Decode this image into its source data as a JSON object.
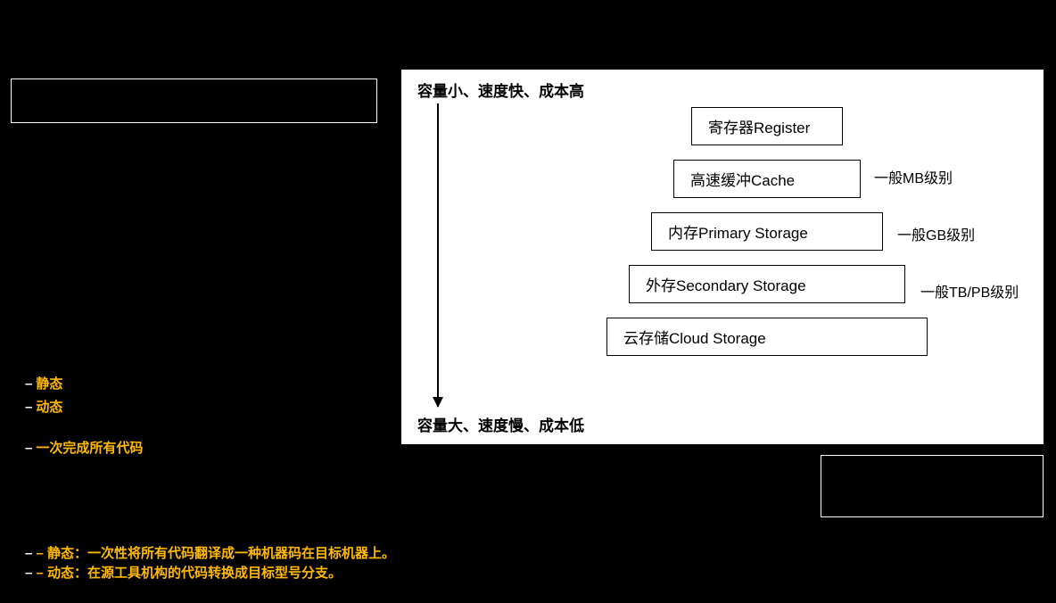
{
  "left_box": "",
  "list": {
    "i1": "静态",
    "i2": "动态",
    "i3": "一次完成所有代码",
    "gap": "",
    "i4": ""
  },
  "bottom": {
    "l1_h": "– 静态：",
    "l1_t": "一次性将所有代码翻译成一种机器码在目标机器上。",
    "l2_h": "– 动态：",
    "l2_t": "在源工具机构的代码转换成目标型号分支。"
  },
  "chart_data": {
    "type": "diagram",
    "title_top": "容量小、速度快、成本高",
    "title_bottom": "容量大、速度慢、成本低",
    "levels": [
      {
        "name": "寄存器Register",
        "note": ""
      },
      {
        "name": "高速缓冲Cache",
        "note": "一般MB级别"
      },
      {
        "name": "内存Primary Storage",
        "note": "一般GB级别"
      },
      {
        "name": "外存Secondary Storage",
        "note": "一般TB/PB级别"
      },
      {
        "name": "云存储Cloud Storage",
        "note": ""
      }
    ]
  }
}
